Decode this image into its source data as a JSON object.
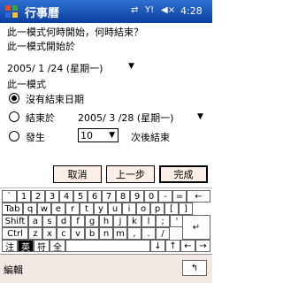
{
  "titlebar": {
    "title": "行事曆",
    "time": "4:28",
    "icons": [
      "windows-start-icon",
      "connectivity-icon",
      "signal-icon",
      "speaker-icon"
    ]
  },
  "form": {
    "question": "此一模式何時開始，何時結束？",
    "start_label": "此一模式開始於",
    "start_date": "2005/ 1 /24  (星期一)",
    "pattern_label": "此一模式",
    "options": [
      {
        "label": "沒有結束日期",
        "checked": true
      },
      {
        "label": "結束於",
        "checked": false,
        "date": "2005/ 3 /28  (星期一)"
      },
      {
        "label": "發生",
        "checked": false,
        "count": "10",
        "suffix": "次後結束"
      }
    ]
  },
  "buttons": {
    "cancel": "取消",
    "back": "上一步",
    "finish": "完成"
  },
  "keyboard": {
    "row1": [
      "`",
      "1",
      "2",
      "3",
      "4",
      "5",
      "6",
      "7",
      "8",
      "9",
      "0",
      "-",
      "=",
      "←"
    ],
    "row2": [
      "Tab",
      "q",
      "w",
      "e",
      "r",
      "t",
      "y",
      "u",
      "i",
      "o",
      "p",
      "[",
      "]"
    ],
    "row3": [
      "Shift",
      "a",
      "s",
      "d",
      "f",
      "g",
      "h",
      "j",
      "k",
      "l",
      ";",
      "'"
    ],
    "row4": [
      "Ctrl",
      "z",
      "x",
      "c",
      "v",
      "b",
      "n",
      "m",
      ",",
      ".",
      "/",
      "↵"
    ],
    "row5": [
      "注",
      "英",
      "符",
      "全",
      "↓",
      "↑",
      "←",
      "→"
    ]
  },
  "menubar": {
    "edit": "編輯",
    "toggle": "↰"
  },
  "colors": {
    "titlebar": "#1f5dbd",
    "button_bg": "#fbeee6",
    "menubar_bg": "#f3e9e4"
  }
}
